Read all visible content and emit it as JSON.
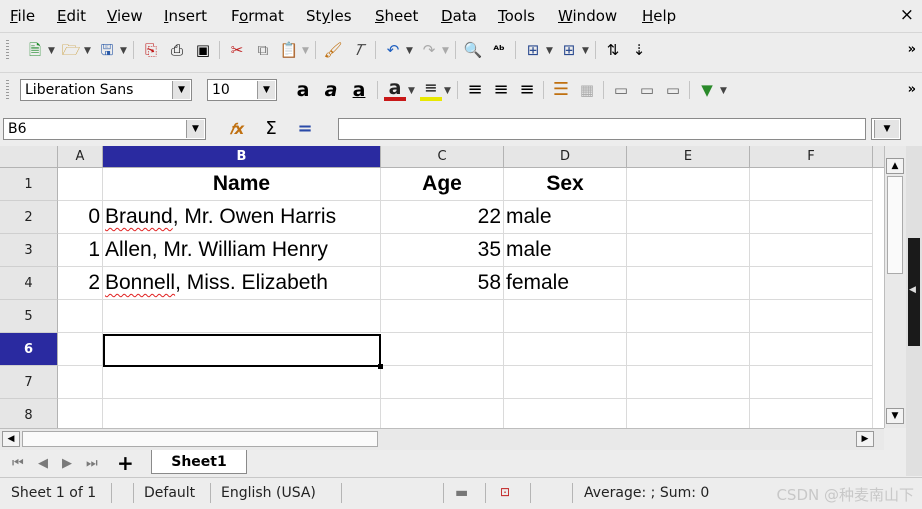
{
  "menu": {
    "items": [
      {
        "label": "File",
        "key": "F",
        "rest": "ile"
      },
      {
        "label": "Edit",
        "key": "E",
        "rest": "dit"
      },
      {
        "label": "View",
        "key": "V",
        "rest": "iew"
      },
      {
        "label": "Insert",
        "key": "I",
        "rest": "nsert"
      },
      {
        "label": "Format",
        "pre": "F",
        "key": "o",
        "rest": "rmat"
      },
      {
        "label": "Styles",
        "pre": "St",
        "key": "y",
        "rest": "les"
      },
      {
        "label": "Sheet",
        "key": "S",
        "rest": "heet"
      },
      {
        "label": "Data",
        "key": "D",
        "rest": "ata"
      },
      {
        "label": "Tools",
        "key": "T",
        "rest": "ools"
      },
      {
        "label": "Window",
        "key": "W",
        "rest": "indow"
      },
      {
        "label": "Help",
        "key": "H",
        "rest": "elp"
      }
    ],
    "close": "×"
  },
  "formatting": {
    "font_name": "Liberation Sans",
    "font_size": "10"
  },
  "formula_bar": {
    "cell_ref": "B6",
    "formula": ""
  },
  "grid": {
    "columns": [
      "A",
      "B",
      "C",
      "D",
      "E",
      "F"
    ],
    "rows": [
      "1",
      "2",
      "3",
      "4",
      "5",
      "6",
      "7",
      "8"
    ],
    "selected_column": "B",
    "selected_row": "6",
    "header": {
      "name": "Name",
      "age": "Age",
      "sex": "Sex"
    },
    "records": [
      {
        "index": "0",
        "name_first": "Braund",
        "name_rest": ", Mr. Owen Harris",
        "age": "22",
        "sex": "male"
      },
      {
        "index": "1",
        "name_first": "Allen, Mr. William Henry",
        "name_rest": "",
        "age": "35",
        "sex": "male"
      },
      {
        "index": "2",
        "name_first": "Bonnell",
        "name_rest": ", Miss. Elizabeth",
        "age": "58",
        "sex": "female"
      }
    ]
  },
  "tabs": {
    "add": "+",
    "sheet_name": "Sheet1"
  },
  "status": {
    "sheet": "Sheet 1 of 1",
    "page_style": "Default",
    "language": "English (USA)",
    "sum": "Average: ; Sum: 0",
    "watermark": "CSDN @种麦南山下"
  }
}
